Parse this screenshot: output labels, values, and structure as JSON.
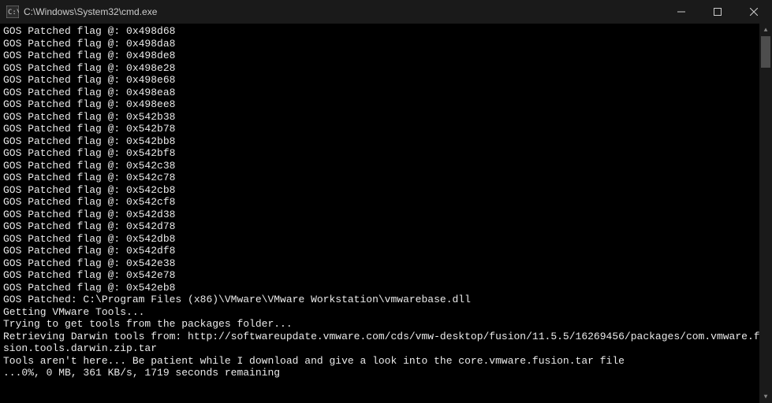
{
  "titlebar": {
    "title": "C:\\Windows\\System32\\cmd.exe"
  },
  "terminal": {
    "lines": [
      "GOS Patched flag @: 0x498d68",
      "GOS Patched flag @: 0x498da8",
      "GOS Patched flag @: 0x498de8",
      "GOS Patched flag @: 0x498e28",
      "GOS Patched flag @: 0x498e68",
      "GOS Patched flag @: 0x498ea8",
      "GOS Patched flag @: 0x498ee8",
      "GOS Patched flag @: 0x542b38",
      "GOS Patched flag @: 0x542b78",
      "GOS Patched flag @: 0x542bb8",
      "GOS Patched flag @: 0x542bf8",
      "GOS Patched flag @: 0x542c38",
      "GOS Patched flag @: 0x542c78",
      "GOS Patched flag @: 0x542cb8",
      "GOS Patched flag @: 0x542cf8",
      "GOS Patched flag @: 0x542d38",
      "GOS Patched flag @: 0x542d78",
      "GOS Patched flag @: 0x542db8",
      "GOS Patched flag @: 0x542df8",
      "GOS Patched flag @: 0x542e38",
      "GOS Patched flag @: 0x542e78",
      "GOS Patched flag @: 0x542eb8",
      "GOS Patched: C:\\Program Files (x86)\\VMware\\VMware Workstation\\vmwarebase.dll",
      "",
      "Getting VMware Tools...",
      "Trying to get tools from the packages folder...",
      "Retrieving Darwin tools from: http://softwareupdate.vmware.com/cds/vmw-desktop/fusion/11.5.5/16269456/packages/com.vmware.fusion.tools.darwin.zip.tar",
      "Tools aren't here... Be patient while I download and give a look into the core.vmware.fusion.tar file",
      "...0%, 0 MB, 361 KB/s, 1719 seconds remaining"
    ]
  }
}
